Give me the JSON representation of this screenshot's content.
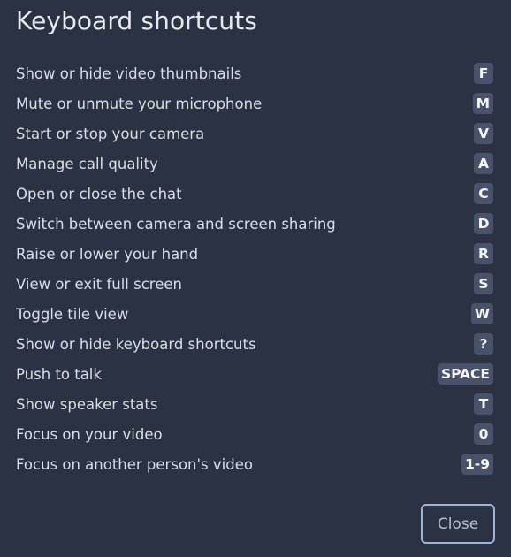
{
  "dialog": {
    "title": "Keyboard shortcuts",
    "close_label": "Close"
  },
  "shortcuts": [
    {
      "label": "Show or hide video thumbnails",
      "key": "F"
    },
    {
      "label": "Mute or unmute your microphone",
      "key": "M"
    },
    {
      "label": "Start or stop your camera",
      "key": "V"
    },
    {
      "label": "Manage call quality",
      "key": "A"
    },
    {
      "label": "Open or close the chat",
      "key": "C"
    },
    {
      "label": "Switch between camera and screen sharing",
      "key": "D"
    },
    {
      "label": "Raise or lower your hand",
      "key": "R"
    },
    {
      "label": "View or exit full screen",
      "key": "S"
    },
    {
      "label": "Toggle tile view",
      "key": "W"
    },
    {
      "label": "Show or hide keyboard shortcuts",
      "key": "?"
    },
    {
      "label": "Push to talk",
      "key": "SPACE"
    },
    {
      "label": "Show speaker stats",
      "key": "T"
    },
    {
      "label": "Focus on your video",
      "key": "0"
    },
    {
      "label": "Focus on another person's video",
      "key": "1-9"
    }
  ],
  "colors": {
    "background": "#2a3243",
    "key_badge": "#48526b",
    "close_border": "#9db6d8"
  }
}
